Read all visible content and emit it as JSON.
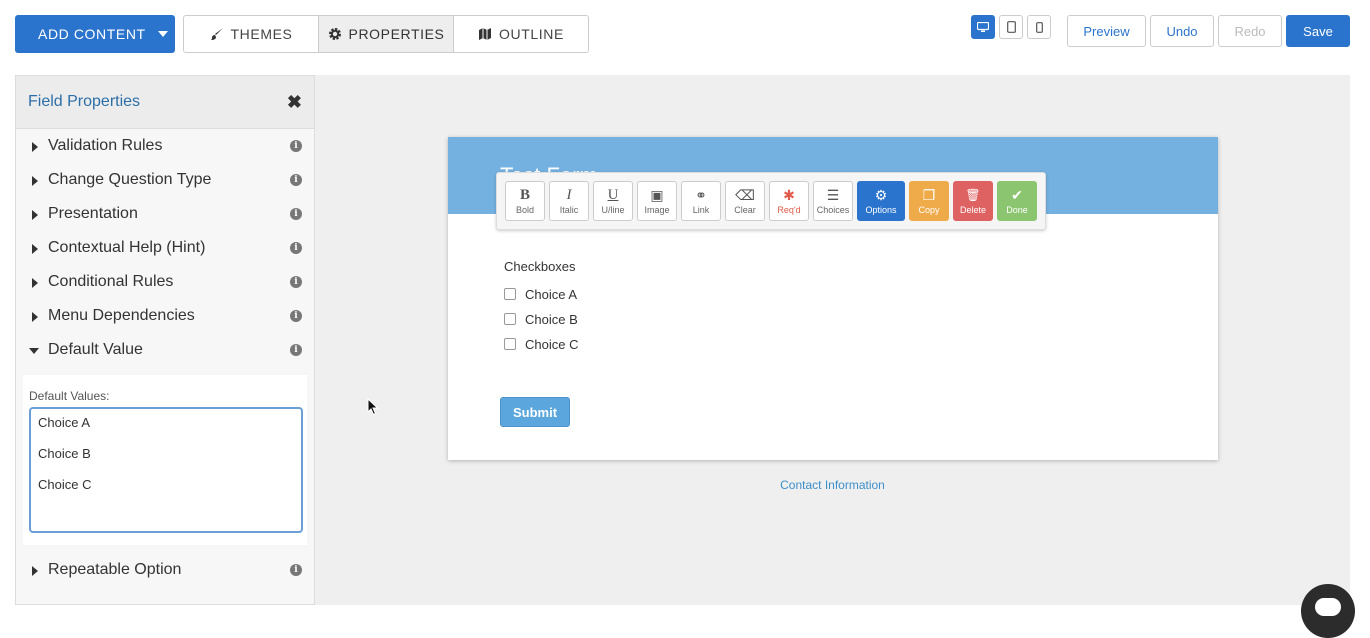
{
  "header": {
    "add_content_label": "ADD CONTENT",
    "tabs": [
      {
        "label": "THEMES",
        "icon": "brush-icon"
      },
      {
        "label": "PROPERTIES",
        "icon": "gear-icon"
      },
      {
        "label": "OUTLINE",
        "icon": "map-icon"
      }
    ],
    "devices": [
      {
        "icon": "desktop-icon",
        "active": true
      },
      {
        "icon": "tablet-icon",
        "active": false
      },
      {
        "icon": "phone-icon",
        "active": false
      }
    ],
    "preview_label": "Preview",
    "undo_label": "Undo",
    "redo_label": "Redo",
    "save_label": "Save"
  },
  "panel": {
    "title": "Field Properties",
    "close_glyph": "✖",
    "sections": [
      {
        "label": "Validation Rules",
        "expanded": false
      },
      {
        "label": "Change Question Type",
        "expanded": false
      },
      {
        "label": "Presentation",
        "expanded": false
      },
      {
        "label": "Contextual Help (Hint)",
        "expanded": false
      },
      {
        "label": "Conditional Rules",
        "expanded": false
      },
      {
        "label": "Menu Dependencies",
        "expanded": false
      },
      {
        "label": "Default Value",
        "expanded": true
      },
      {
        "label": "Repeatable Option",
        "expanded": false
      }
    ],
    "default_values_label": "Default Values:",
    "default_values": [
      "Choice A",
      "Choice B",
      "Choice C"
    ]
  },
  "form": {
    "title": "Test Form",
    "question_label": "Checkboxes",
    "choices": [
      "Choice A",
      "Choice B",
      "Choice C"
    ],
    "submit_label": "Submit",
    "footer_link": "Contact Information"
  },
  "toolbar": {
    "buttons": [
      {
        "label": "Bold",
        "glyph": "B",
        "icon": "bold-icon"
      },
      {
        "label": "Italic",
        "glyph": "I",
        "icon": "italic-icon"
      },
      {
        "label": "U/line",
        "glyph": "U",
        "icon": "underline-icon"
      },
      {
        "label": "Image",
        "glyph": "▣",
        "icon": "image-icon"
      },
      {
        "label": "Link",
        "glyph": "⚭",
        "icon": "link-icon"
      },
      {
        "label": "Clear",
        "glyph": "⌫",
        "icon": "eraser-icon"
      },
      {
        "label": "Req'd",
        "glyph": "✱",
        "icon": "asterisk-icon"
      },
      {
        "label": "Choices",
        "glyph": "☰",
        "icon": "list-icon"
      },
      {
        "label": "Options",
        "glyph": "⚙",
        "icon": "gear-icon"
      },
      {
        "label": "Copy",
        "glyph": "❐",
        "icon": "copy-icon"
      },
      {
        "label": "Delete",
        "glyph": "🗑",
        "icon": "trash-icon"
      },
      {
        "label": "Done",
        "glyph": "✔",
        "icon": "check-icon"
      }
    ]
  },
  "colors": {
    "primary": "#2b74cd",
    "form_header": "#74b1e0",
    "copy": "#efab4a",
    "delete": "#de6262",
    "done": "#8bc56f",
    "required": "#e05b4b"
  }
}
